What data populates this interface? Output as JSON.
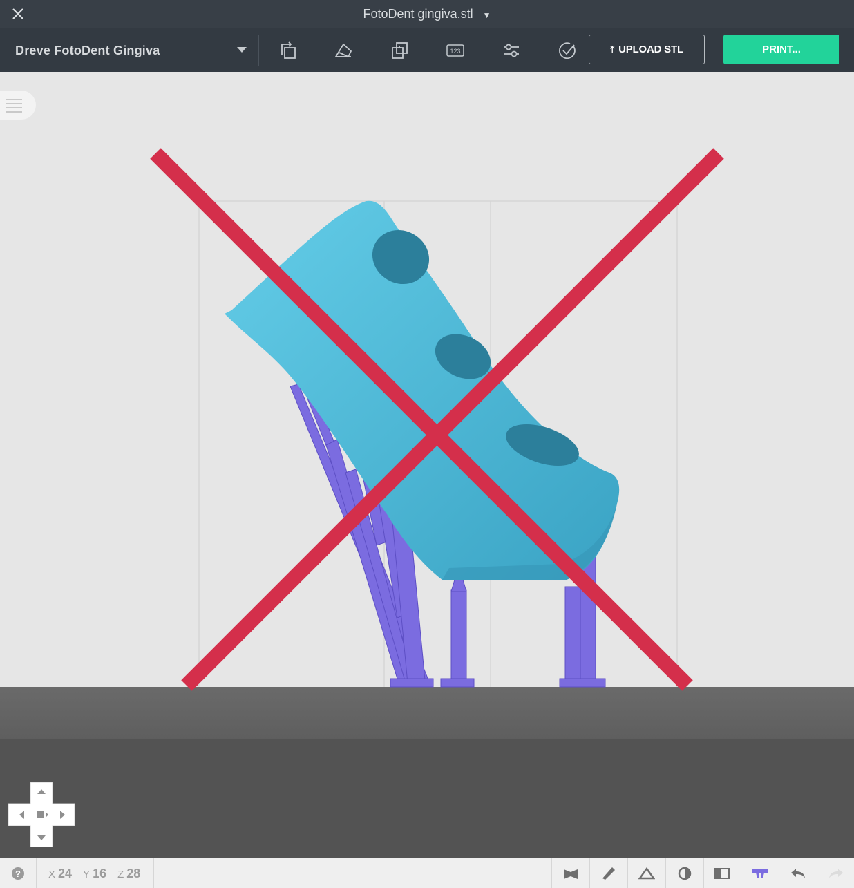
{
  "window": {
    "title": "FotoDent gingiva.stl"
  },
  "toolbar": {
    "material": "Dreve FotoDent Gingiva",
    "tools": [
      "orientation-icon",
      "support-icon",
      "layout-icon",
      "labels-icon",
      "settings-icon",
      "check-icon"
    ],
    "upload_label": "UPLOAD STL",
    "print_label": "PRINT..."
  },
  "status": {
    "coords": [
      {
        "axis": "X",
        "value": "24"
      },
      {
        "axis": "Y",
        "value": "16"
      },
      {
        "axis": "Z",
        "value": "28"
      }
    ]
  },
  "colors": {
    "title_bar": "#383f47",
    "toolbar": "#333a42",
    "print_button": "#22d39a",
    "model": "#4fb8d6",
    "supports": "#7b6ce0",
    "cross_mark": "#d42f4b",
    "build_plate": "#656565"
  }
}
